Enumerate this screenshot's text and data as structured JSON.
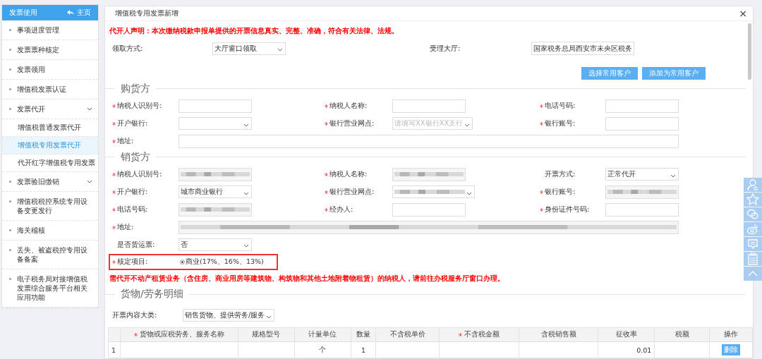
{
  "sidebar": {
    "title": "发票使用",
    "home": "主页",
    "items": [
      {
        "label": "事项进度管理"
      },
      {
        "label": "发票票种核定"
      },
      {
        "label": "发票领用"
      },
      {
        "label": "增值税发票认证"
      },
      {
        "label": "发票代开",
        "kind": "group",
        "children": [
          {
            "label": "增值税普通发票代开",
            "selected": false
          },
          {
            "label": "增值税专用发票代开",
            "selected": true
          },
          {
            "label": "代开红字增值税专用发票",
            "selected": false
          }
        ]
      },
      {
        "label": "发票验旧缴销",
        "kind": "group"
      },
      {
        "label": "增值税税控系统专用设备变更发行"
      },
      {
        "label": "海关稽核"
      },
      {
        "label": "丢失、被盗税控专用设备备案"
      },
      {
        "label": "电子税务局对接增值税发票综合服务平台相关应用功能"
      }
    ]
  },
  "dialog": {
    "title": "增值税专用发票新增",
    "close": "×",
    "notice": "代开人声明：本次缴纳税款申报单提供的开票信息真实、完整、准确，符合有关法律、法规。",
    "pickup": {
      "label": "领取方式:",
      "value": "大厅窗口领取"
    },
    "hall": {
      "label": "受理大厅:",
      "value": "国家税务总局西安市未央区税务"
    },
    "buttons": [
      "选择常用客户",
      "添加为常用客户"
    ],
    "buyer": {
      "heading": "购货方",
      "fields": [
        {
          "label": "纳税人识别号:",
          "required": true,
          "kind": "input"
        },
        {
          "label": "纳税人名称:",
          "required": true,
          "kind": "input"
        },
        {
          "label": "电话号码:",
          "required": true,
          "kind": "input"
        },
        {
          "label": "开户银行:",
          "required": true,
          "kind": "select"
        },
        {
          "label": "银行营业网点:",
          "required": true,
          "kind": "select",
          "placeholder": "请填写XX银行XX支行"
        },
        {
          "label": "银行账号:",
          "required": true,
          "kind": "input"
        },
        {
          "label": "地址:",
          "required": true,
          "kind": "wide"
        }
      ]
    },
    "seller": {
      "heading": "销货方",
      "fields": [
        {
          "label": "纳税人识别号:",
          "required": true,
          "kind": "input",
          "redacted": true
        },
        {
          "label": "纳税人名称:",
          "required": true,
          "kind": "input",
          "redacted": true
        },
        {
          "label": "开票方式:",
          "required": false,
          "kind": "select",
          "value": "正常代开"
        },
        {
          "label": "开户银行:",
          "required": true,
          "kind": "select",
          "value": "城市商业银行"
        },
        {
          "label": "银行营业网点:",
          "required": true,
          "kind": "select",
          "redacted": true
        },
        {
          "label": "银行账号:",
          "required": true,
          "kind": "input",
          "redacted": true
        },
        {
          "label": "电话号码:",
          "required": true,
          "kind": "input",
          "redacted": true
        },
        {
          "label": "经办人:",
          "required": true,
          "kind": "input"
        },
        {
          "label": "身份证件号码:",
          "required": true,
          "kind": "input"
        },
        {
          "label": "地址:",
          "required": true,
          "kind": "wide",
          "redacted": true
        },
        {
          "label": "是否货运票:",
          "required": false,
          "kind": "select",
          "value": "否"
        }
      ]
    },
    "verified": {
      "label": "核定项目:",
      "required": true,
      "option": "商业(17%、16%、13%)",
      "selected": true
    },
    "warning": "需代开不动产租赁业务（含住房、商业用房等建筑物、构筑物和其他土地附着物租赁）的纳税人，请前往办税服务厅窗口办理。",
    "goods": {
      "heading": "货物/劳务明细",
      "category": {
        "label": "开票内容大类:",
        "value": "销售货物、提供劳务/服务"
      },
      "table": {
        "columns": [
          {},
          {
            "label": "货物或应税劳务、服务名称",
            "required": true
          },
          {
            "label": "规格型号"
          },
          {
            "label": "计量单位"
          },
          {
            "label": "数量"
          },
          {
            "label": "不含税单价"
          },
          {
            "label": "不含税金额",
            "required": true
          },
          {
            "label": "含税销售额"
          },
          {
            "label": "征收率"
          },
          {
            "label": "税额"
          },
          {
            "label": "操作"
          }
        ],
        "rows": [
          {
            "cells": [
              "1",
              "",
              "",
              "个",
              "1",
              "",
              "",
              "",
              "0.01",
              ""
            ],
            "action": "删除"
          }
        ]
      }
    }
  }
}
